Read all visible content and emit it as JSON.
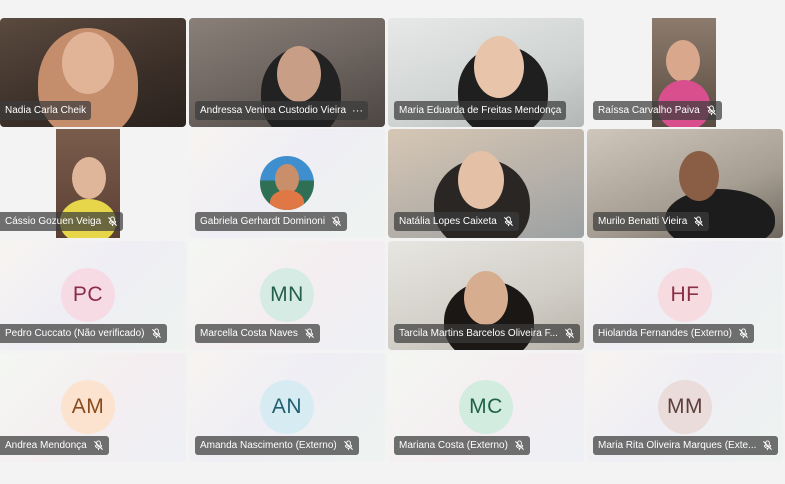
{
  "participants": [
    {
      "name": "Nadia Carla Cheik",
      "muted": false,
      "more": false
    },
    {
      "name": "Andressa Venina Custodio Vieira",
      "muted": false,
      "more": true
    },
    {
      "name": "Maria Eduarda de Freitas Mendonça",
      "muted": false,
      "more": false
    },
    {
      "name": "Raíssa Carvalho Paiva",
      "muted": true
    },
    {
      "name": "Cássio Gozuen Veiga",
      "muted": true
    },
    {
      "name": "Gabriela Gerhardt Dominoni",
      "muted": true
    },
    {
      "name": "Natália Lopes Caixeta",
      "muted": true
    },
    {
      "name": "Murilo Benatti Vieira",
      "muted": true
    },
    {
      "name": "Pedro Cuccato (Não verificado)",
      "initials": "PC",
      "muted": true
    },
    {
      "name": "Marcella Costa Naves",
      "initials": "MN",
      "muted": true
    },
    {
      "name": "Tarcila Martins Barcelos Oliveira F...",
      "muted": true
    },
    {
      "name": "Hiolanda Fernandes (Externo)",
      "initials": "HF",
      "muted": true
    },
    {
      "name": "Andrea Mendonça",
      "initials": "AM",
      "muted": true
    },
    {
      "name": "Amanda Nascimento (Externo)",
      "initials": "AN",
      "muted": true
    },
    {
      "name": "Mariana Costa (Externo)",
      "initials": "MC",
      "muted": true
    },
    {
      "name": "Maria Rita Oliveira Marques (Exte...",
      "initials": "MM",
      "muted": true
    }
  ],
  "more_icon": "···",
  "avatar_colors": {
    "PC": {
      "bg": "#f6dbe4",
      "fg": "#8a2c4a"
    },
    "MN": {
      "bg": "#d6ebe3",
      "fg": "#245e4c"
    },
    "HF": {
      "bg": "#f6dbe0",
      "fg": "#8b2f44"
    },
    "AM": {
      "bg": "#fbe3cf",
      "fg": "#8a4a1c"
    },
    "AN": {
      "bg": "#d7ecf2",
      "fg": "#1f5f6f"
    },
    "MC": {
      "bg": "#d3ece0",
      "fg": "#1f6247"
    },
    "MM": {
      "bg": "#eadcda",
      "fg": "#5d3e3a"
    }
  }
}
